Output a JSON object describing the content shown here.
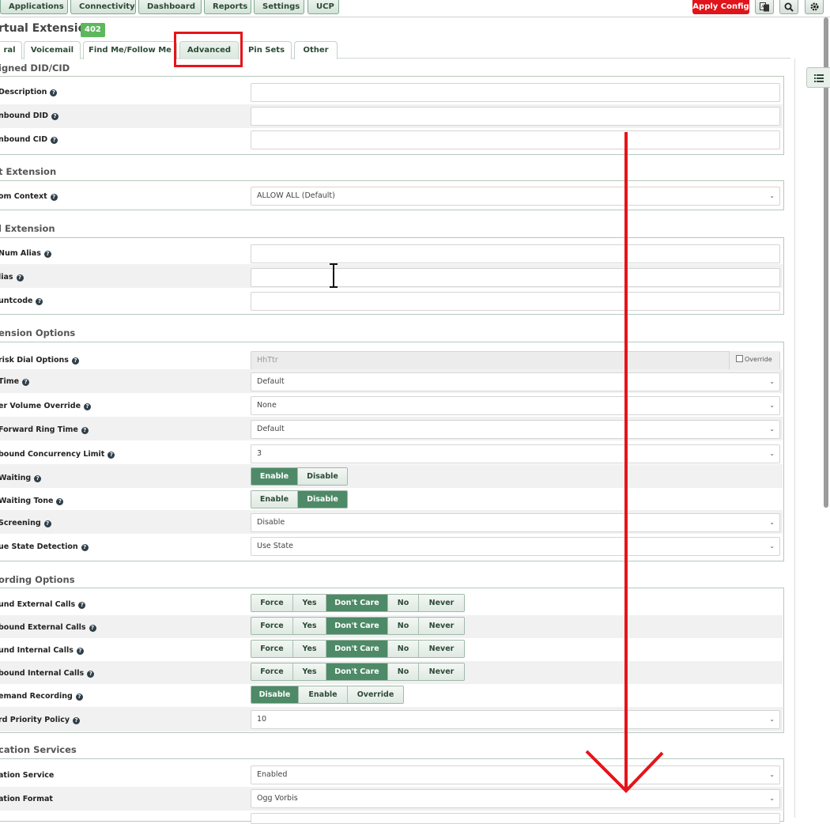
{
  "nav": {
    "items": [
      "Applications",
      "Connectivity",
      "Dashboard",
      "Reports",
      "Settings",
      "UCP"
    ],
    "apply_config": "Apply Config"
  },
  "header": {
    "title": "rtual Extension",
    "badge": "402"
  },
  "tabs": [
    "ral",
    "Voicemail",
    "Find Me/Follow Me",
    "Advanced",
    "Pin Sets",
    "Other"
  ],
  "active_tab": "Advanced",
  "sections": {
    "assigned": {
      "title": "igned DID/CID",
      "rows": [
        {
          "label": "Description",
          "value": ""
        },
        {
          "label": "nbound DID",
          "value": ""
        },
        {
          "label": "nbound CID",
          "value": ""
        }
      ]
    },
    "outbound": {
      "title": "t Extension",
      "rows": [
        {
          "label": "om Context",
          "value": "ALLOW ALL (Default)"
        }
      ]
    },
    "dialing": {
      "title": "l Extension",
      "rows": [
        {
          "label": "Num Alias",
          "value": ""
        },
        {
          "label": "lias",
          "value": ""
        },
        {
          "label": "untcode",
          "value": ""
        }
      ]
    },
    "options": {
      "title": "ension Options",
      "rows": [
        {
          "label": "risk Dial Options",
          "value": "HhTtr",
          "override": "Override"
        },
        {
          "label": "Time",
          "value": "Default"
        },
        {
          "label": "er Volume Override",
          "value": "None"
        },
        {
          "label": "Forward Ring Time",
          "value": "Default"
        },
        {
          "label": "bound Concurrency Limit",
          "value": "3"
        },
        {
          "label": "Waiting",
          "options": [
            "Enable",
            "Disable"
          ],
          "selected": "Enable"
        },
        {
          "label": "Waiting Tone",
          "options": [
            "Enable",
            "Disable"
          ],
          "selected": "Disable"
        },
        {
          "label": "Screening",
          "value": "Disable"
        },
        {
          "label": "ue State Detection",
          "value": "Use State"
        }
      ]
    },
    "recording": {
      "title": "ording Options",
      "rows": [
        {
          "label": "und External Calls",
          "options": [
            "Force",
            "Yes",
            "Don't Care",
            "No",
            "Never"
          ],
          "selected": "Don't Care"
        },
        {
          "label": "bound External Calls",
          "options": [
            "Force",
            "Yes",
            "Don't Care",
            "No",
            "Never"
          ],
          "selected": "Don't Care"
        },
        {
          "label": "und Internal Calls",
          "options": [
            "Force",
            "Yes",
            "Don't Care",
            "No",
            "Never"
          ],
          "selected": "Don't Care"
        },
        {
          "label": "bound Internal Calls",
          "options": [
            "Force",
            "Yes",
            "Don't Care",
            "No",
            "Never"
          ],
          "selected": "Don't Care"
        },
        {
          "label": "emand Recording",
          "options": [
            "Disable",
            "Enable",
            "Override"
          ],
          "selected": "Disable"
        },
        {
          "label": "rd Priority Policy",
          "value": "10"
        }
      ]
    },
    "services": {
      "title": "cation Services",
      "rows": [
        {
          "label": "ation Service",
          "value": "Enabled"
        },
        {
          "label": "ation Format",
          "value": "Ogg Vorbis"
        }
      ]
    }
  },
  "colors": {
    "accent": "#4e8a67",
    "annotation": "#e6141b",
    "apply": "#e0141a",
    "badge": "#5cb85c"
  },
  "icons": [
    "translate-icon",
    "search-icon",
    "gear-icon",
    "list-icon",
    "chevron-down-icon",
    "help-icon"
  ]
}
